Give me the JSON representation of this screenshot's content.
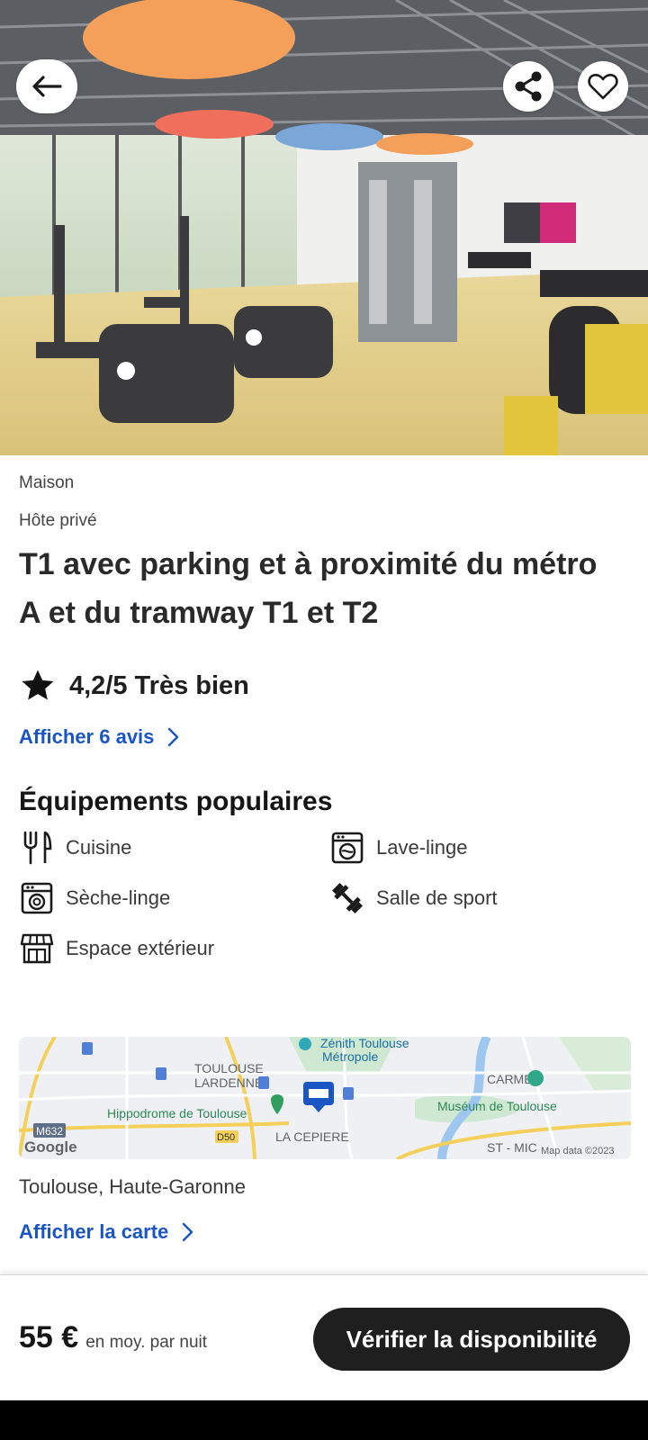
{
  "header": {
    "back_icon": "arrow-left-icon",
    "share_icon": "share-icon",
    "favorite_icon": "heart-icon"
  },
  "hero": {
    "image_description": "gym-photo"
  },
  "property": {
    "category": "Maison",
    "host_type": "Hôte privé",
    "title": "T1 avec parking et à proximité du métro A et du tramway T1 et T2"
  },
  "rating": {
    "text": "4,2/5 Très bien",
    "reviews_link": "Afficher 6 avis"
  },
  "amenities": {
    "title": "Équipements populaires",
    "items": [
      {
        "label": "Cuisine",
        "icon": "utensils-icon"
      },
      {
        "label": "Lave-linge",
        "icon": "washing-machine-icon"
      },
      {
        "label": "Sèche-linge",
        "icon": "dryer-icon"
      },
      {
        "label": "Salle de sport",
        "icon": "dumbbell-icon"
      },
      {
        "label": "Espace extérieur",
        "icon": "outdoor-space-icon"
      }
    ]
  },
  "map": {
    "labels": {
      "zenith": "Zénith Toulouse",
      "zenith2": "Métropole",
      "lardenne1": "TOULOUSE",
      "lardenne2": "LARDENNE",
      "carmes": "CARMES",
      "hippodrome": "Hippodrome de Toulouse",
      "musee": "Muséum de Toulouse",
      "road1": "M632",
      "road2": "D50",
      "cepiere": "LA CEPIERE",
      "stmic": "ST - MIC",
      "google": "Google",
      "copyright": "Map data ©2023"
    },
    "location": "Toulouse, Haute-Garonne",
    "link": "Afficher la carte"
  },
  "booking": {
    "price": "55 €",
    "price_unit": "en moy. par nuit",
    "cta": "Vérifier la disponibilité"
  },
  "colors": {
    "link": "#1a55c4",
    "cta_bg": "#1f1f1f"
  }
}
